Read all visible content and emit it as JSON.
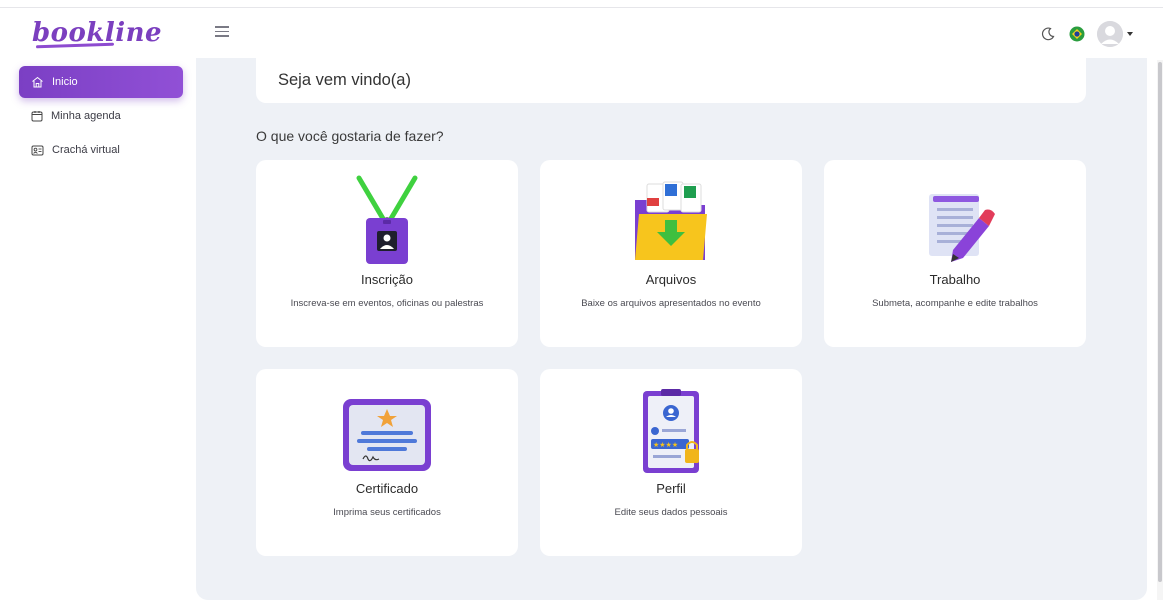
{
  "app": {
    "logo": "bookline"
  },
  "header": {
    "menu_icon": "hamburger-icon",
    "theme_icon": "moon-icon",
    "flag_icon": "brazil-flag-icon",
    "avatar_icon": "user-avatar-icon"
  },
  "sidebar": {
    "items": [
      {
        "label": "Inicio",
        "icon": "home-icon",
        "active": true
      },
      {
        "label": "Minha agenda",
        "icon": "calendar-icon",
        "active": false
      },
      {
        "label": "Crachá virtual",
        "icon": "badge-icon",
        "active": false
      }
    ]
  },
  "main": {
    "welcome": "Seja vem vindo(a)",
    "question": "O que você gostaria de fazer?",
    "cards": [
      {
        "title": "Inscrição",
        "desc": "Inscreva-se em eventos, oficinas ou palestras",
        "icon": "id-badge-icon"
      },
      {
        "title": "Arquivos",
        "desc": "Baixe os arquivos apresentados no evento",
        "icon": "folder-download-icon"
      },
      {
        "title": "Trabalho",
        "desc": "Submeta, acompanhe e edite trabalhos",
        "icon": "document-pencil-icon"
      },
      {
        "title": "Certificado",
        "desc": "Imprima seus certificados",
        "icon": "certificate-icon"
      },
      {
        "title": "Perfil",
        "desc": "Edite seus dados pessoais",
        "icon": "profile-clipboard-icon"
      }
    ]
  },
  "colors": {
    "accent": "#7b3fc4",
    "background": "#eef1f6",
    "card": "#ffffff"
  }
}
